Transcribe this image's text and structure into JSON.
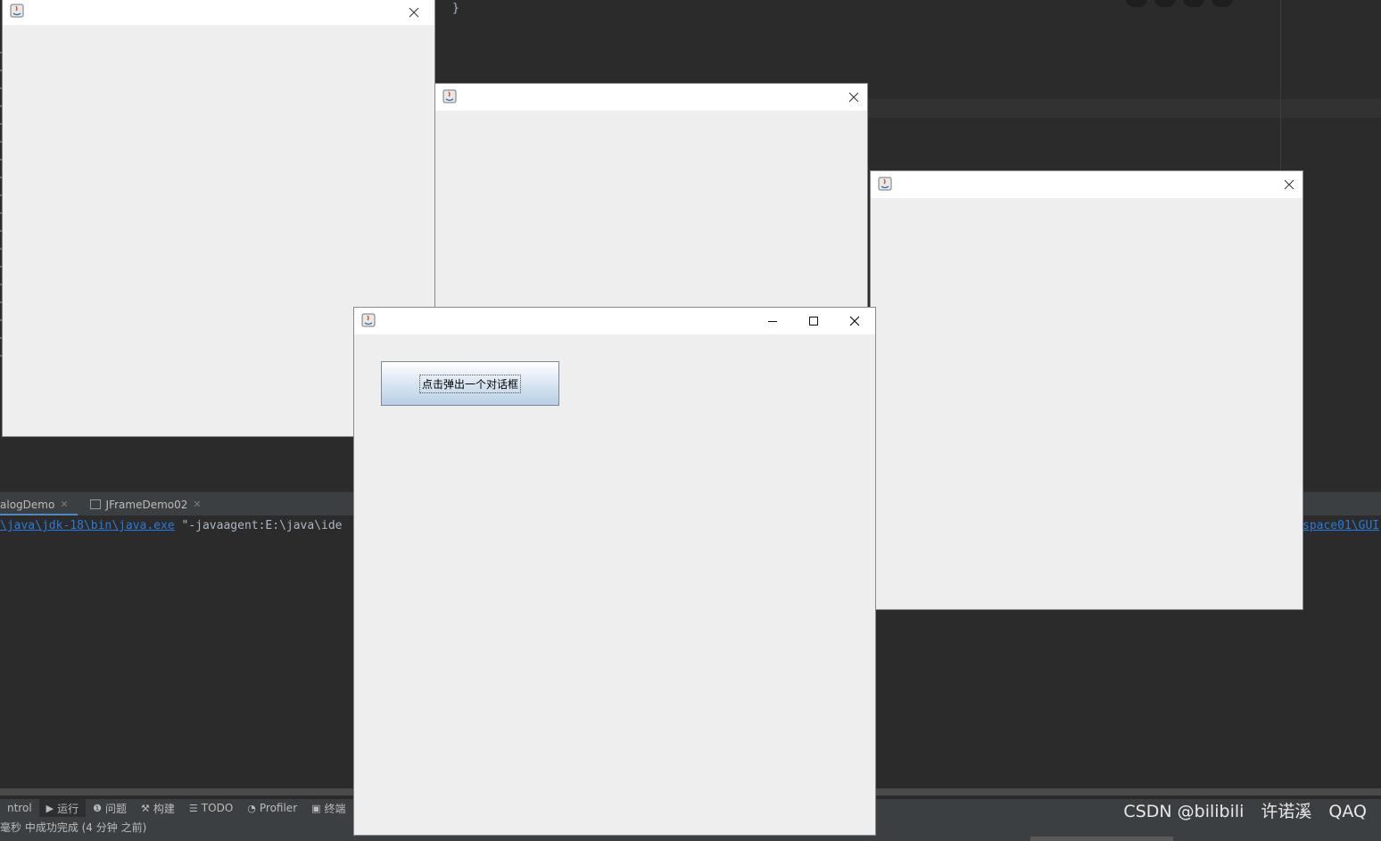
{
  "editor": {
    "closing_brace": "}"
  },
  "run_tabs": [
    {
      "label": "alogDemo",
      "active": true
    },
    {
      "label": "JFrameDemo02",
      "active": false
    }
  ],
  "console": {
    "path_link": "\\java\\jdk-18\\bin\\java.exe",
    "args_text": " \"-javaagent:E:\\java\\ide",
    "right_link": "space01\\GUI"
  },
  "bottom_toolbar": [
    {
      "icon": "",
      "label": "ntrol"
    },
    {
      "icon": "▶",
      "label": "运行"
    },
    {
      "icon": "❶",
      "label": "问题"
    },
    {
      "icon": "⚒",
      "label": "构建"
    },
    {
      "icon": "☰",
      "label": "TODO"
    },
    {
      "icon": "◔",
      "label": "Profiler"
    },
    {
      "icon": "▣",
      "label": "终端"
    }
  ],
  "status": {
    "text": "毫秒 中成功完成 (4 分钟 之前)"
  },
  "watermark": "CSDN @bilibili　许诺溪　QAQ",
  "main_frame": {
    "button_label": "点击弹出一个对话框"
  },
  "colors": {
    "ide_bg": "#2b2b2b",
    "panel_bg": "#3c3f41",
    "link": "#287bde",
    "swing_bg": "#eeeeee"
  }
}
